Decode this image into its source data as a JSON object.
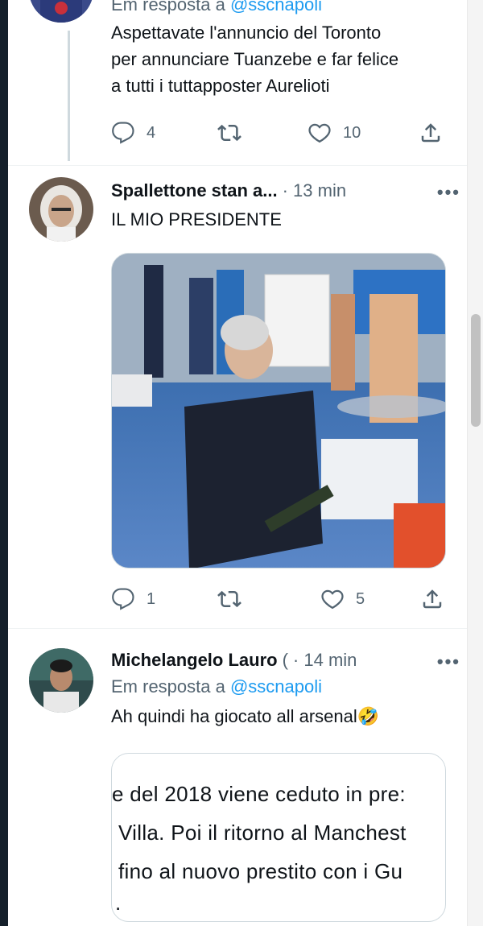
{
  "colors": {
    "accent": "#1d9bf0",
    "muted": "#536471",
    "text": "#0f1419",
    "border": "#cfd9de"
  },
  "tweet1": {
    "reply_to_prefix": "Em resposta a",
    "reply_to_handle": "@sscnapoli",
    "text_lines": [
      "Aspettavate l'annuncio del Toronto",
      "per annunciare Tuanzebe e far felice",
      "a tutti i tuttapposter Aurelioti"
    ],
    "replies": "4",
    "retweets": "",
    "likes": "10"
  },
  "tweet2": {
    "name": "Spallettone stan a...",
    "time": "· 13 min",
    "more": "•••",
    "text": "IL MIO PRESIDENTE",
    "media_type": "video",
    "replies": "1",
    "retweets": "",
    "likes": "5"
  },
  "tweet3": {
    "name": "Michelangelo Lauro",
    "name_suffix": "(",
    "time": "· 14 min",
    "more": "•••",
    "reply_to_prefix": "Em resposta a",
    "reply_to_handle": "@sscnapoli",
    "text": "Ah quindi ha giocato all arsenal",
    "emoji": "🤣",
    "quote_lines": [
      "e del 2018 viene ceduto in pre:",
      "Villa. Poi il ritorno al Manchest",
      "fino al nuovo prestito con i Gu",
      "."
    ]
  },
  "icons": {
    "reply": "reply-icon",
    "retweet": "retweet-icon",
    "like": "heart-icon",
    "share": "share-icon"
  }
}
